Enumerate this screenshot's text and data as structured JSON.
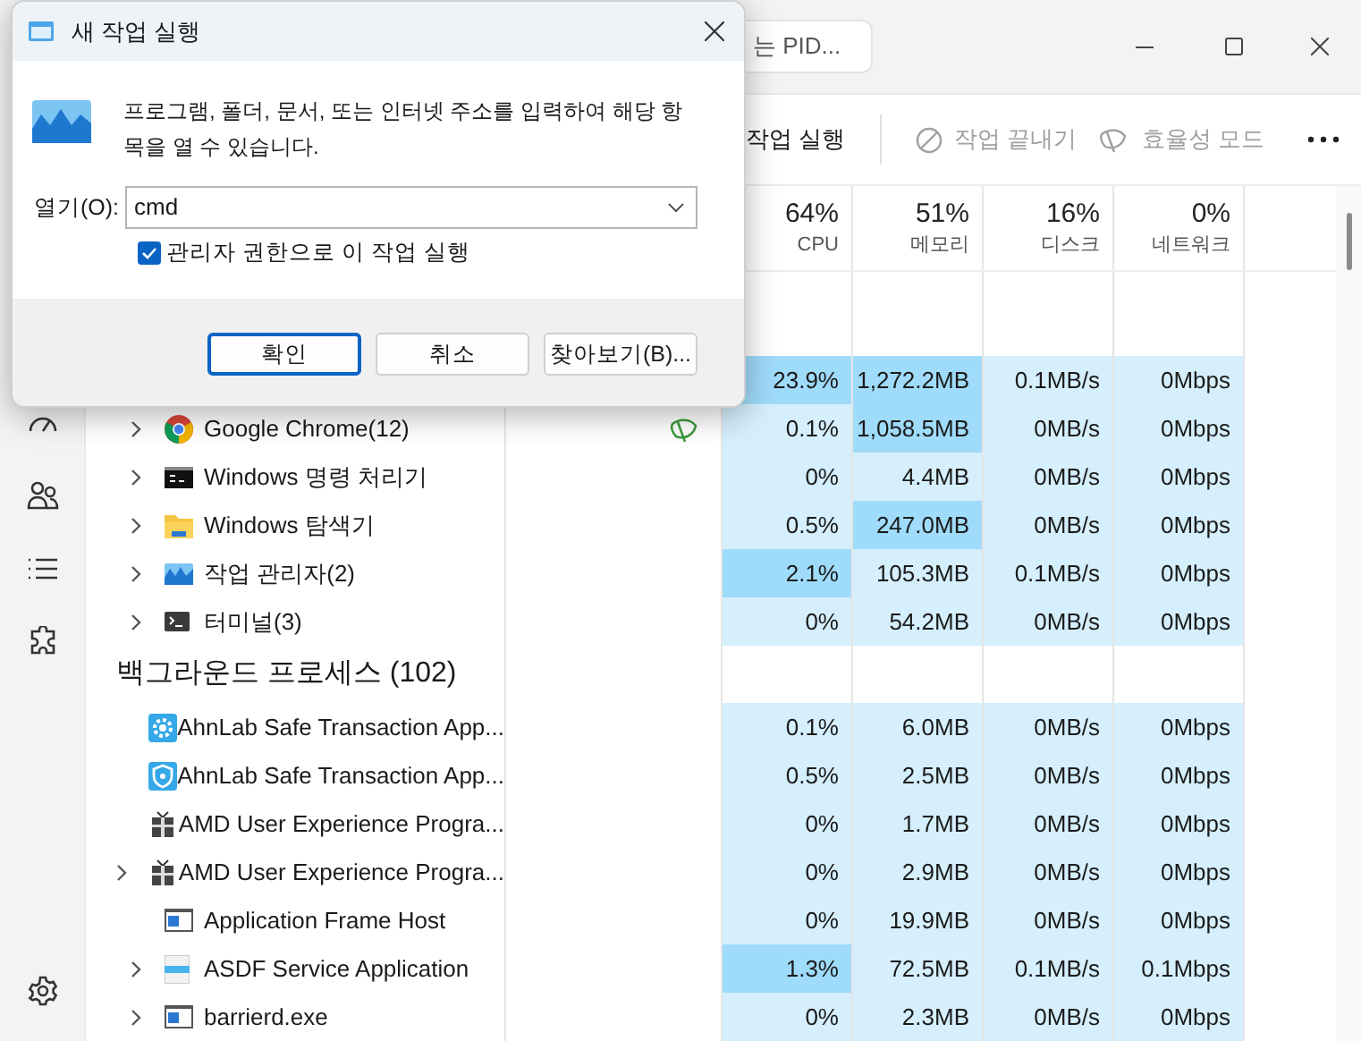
{
  "task_manager": {
    "search": {
      "placeholder": "는 PID..."
    },
    "toolbar": [
      {
        "kind": "run",
        "label": "작업 실행",
        "disabled": false
      },
      {
        "kind": "end",
        "label": "작업 끝내기",
        "disabled": true
      },
      {
        "kind": "efficiency",
        "label": "효율성 모드",
        "disabled": true
      }
    ],
    "nav": [
      {
        "kind": "performance"
      },
      {
        "kind": "users"
      },
      {
        "kind": "details"
      },
      {
        "kind": "services"
      },
      {
        "kind": "settings"
      }
    ],
    "columns": [
      {
        "value": "64%",
        "label": "CPU"
      },
      {
        "value": "51%",
        "label": "메모리"
      },
      {
        "value": "16%",
        "label": "디스크"
      },
      {
        "value": "0%",
        "label": "네트워크"
      }
    ],
    "app_rows": [
      {
        "cells": [
          {
            "text": "23.9%",
            "hot": true
          },
          {
            "text": "1,272.2MB",
            "hot": true
          },
          {
            "text": "0.1MB/s",
            "hot": false
          },
          {
            "text": "0Mbps",
            "hot": false
          }
        ]
      },
      {
        "kind": "chrome",
        "name": "Google Chrome(12)",
        "expandable": true,
        "efficiency": true,
        "cells": [
          {
            "text": "0.1%",
            "hot": false
          },
          {
            "text": "1,058.5MB",
            "hot": true
          },
          {
            "text": "0MB/s",
            "hot": false
          },
          {
            "text": "0Mbps",
            "hot": false
          }
        ]
      },
      {
        "kind": "console",
        "name": "Windows 명령 처리기",
        "expandable": true,
        "efficiency": false,
        "cells": [
          {
            "text": "0%",
            "hot": false
          },
          {
            "text": "4.4MB",
            "hot": false
          },
          {
            "text": "0MB/s",
            "hot": false
          },
          {
            "text": "0Mbps",
            "hot": false
          }
        ]
      },
      {
        "kind": "folder",
        "name": "Windows 탐색기",
        "expandable": true,
        "efficiency": false,
        "cells": [
          {
            "text": "0.5%",
            "hot": false
          },
          {
            "text": "247.0MB",
            "hot": true
          },
          {
            "text": "0MB/s",
            "hot": false
          },
          {
            "text": "0Mbps",
            "hot": false
          }
        ]
      },
      {
        "kind": "taskmgr",
        "name": "작업 관리자(2)",
        "expandable": true,
        "efficiency": false,
        "cells": [
          {
            "text": "2.1%",
            "hot": true
          },
          {
            "text": "105.3MB",
            "hot": false
          },
          {
            "text": "0.1MB/s",
            "hot": false
          },
          {
            "text": "0Mbps",
            "hot": false
          }
        ]
      },
      {
        "kind": "terminal",
        "name": "터미널(3)",
        "expandable": true,
        "efficiency": false,
        "cells": [
          {
            "text": "0%",
            "hot": false
          },
          {
            "text": "54.2MB",
            "hot": false
          },
          {
            "text": "0MB/s",
            "hot": false
          },
          {
            "text": "0Mbps",
            "hot": false
          }
        ]
      }
    ],
    "background_group": {
      "title": "백그라운드 프로세스 (102)",
      "rows": [
        {
          "kind": "gear",
          "name": "AhnLab Safe Transaction App...",
          "expandable": false,
          "efficiency": false,
          "cells": [
            {
              "text": "0.1%",
              "hot": false
            },
            {
              "text": "6.0MB",
              "hot": false
            },
            {
              "text": "0MB/s",
              "hot": false
            },
            {
              "text": "0Mbps",
              "hot": false
            }
          ]
        },
        {
          "kind": "shield",
          "name": "AhnLab Safe Transaction App...",
          "expandable": false,
          "efficiency": false,
          "cells": [
            {
              "text": "0.5%",
              "hot": false
            },
            {
              "text": "2.5MB",
              "hot": false
            },
            {
              "text": "0MB/s",
              "hot": false
            },
            {
              "text": "0Mbps",
              "hot": false
            }
          ]
        },
        {
          "kind": "gift",
          "name": "AMD User Experience Progra...",
          "expandable": false,
          "efficiency": false,
          "cells": [
            {
              "text": "0%",
              "hot": false
            },
            {
              "text": "1.7MB",
              "hot": false
            },
            {
              "text": "0MB/s",
              "hot": false
            },
            {
              "text": "0Mbps",
              "hot": false
            }
          ]
        },
        {
          "kind": "gift",
          "name": "AMD User Experience Progra...",
          "expandable": true,
          "efficiency": false,
          "cells": [
            {
              "text": "0%",
              "hot": false
            },
            {
              "text": "2.9MB",
              "hot": false
            },
            {
              "text": "0MB/s",
              "hot": false
            },
            {
              "text": "0Mbps",
              "hot": false
            }
          ]
        },
        {
          "kind": "window",
          "name": "Application Frame Host",
          "expandable": false,
          "efficiency": false,
          "cells": [
            {
              "text": "0%",
              "hot": false
            },
            {
              "text": "19.9MB",
              "hot": false
            },
            {
              "text": "0MB/s",
              "hot": false
            },
            {
              "text": "0Mbps",
              "hot": false
            }
          ]
        },
        {
          "kind": "document",
          "name": "ASDF Service Application",
          "expandable": true,
          "efficiency": false,
          "cells": [
            {
              "text": "1.3%",
              "hot": true
            },
            {
              "text": "72.5MB",
              "hot": false
            },
            {
              "text": "0.1MB/s",
              "hot": false
            },
            {
              "text": "0.1Mbps",
              "hot": false
            }
          ]
        },
        {
          "kind": "window",
          "name": "barrierd.exe",
          "expandable": true,
          "efficiency": false,
          "cells": [
            {
              "text": "0%",
              "hot": false
            },
            {
              "text": "2.3MB",
              "hot": false
            },
            {
              "text": "0MB/s",
              "hot": false
            },
            {
              "text": "0Mbps",
              "hot": false
            }
          ]
        }
      ]
    }
  },
  "dialog": {
    "title": "새 작업 실행",
    "message": "프로그램, 폴더, 문서, 또는 인터넷 주소를 입력하여 해당 항목을 열 수 있습니다.",
    "open_label": "열기(O):",
    "open_value": "cmd",
    "admin": {
      "label": "관리자 권한으로 이 작업 실행",
      "checked": true
    },
    "buttons": [
      {
        "label": "확인",
        "default": true
      },
      {
        "label": "취소",
        "default": false
      },
      {
        "label": "찾아보기(B)...",
        "default": false
      }
    ]
  }
}
